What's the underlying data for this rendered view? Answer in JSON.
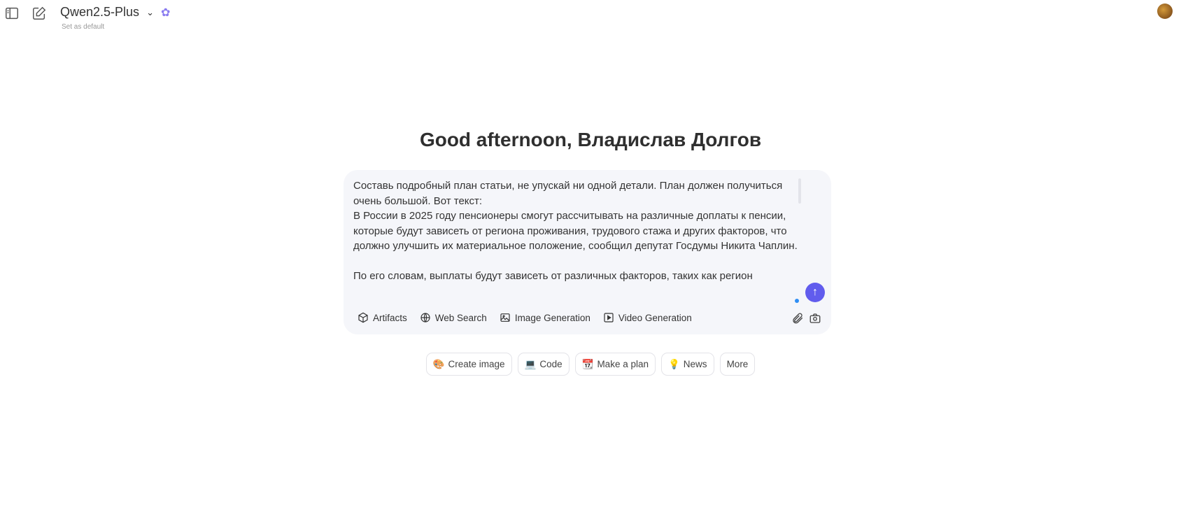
{
  "header": {
    "model_name": "Qwen2.5-Plus",
    "set_default": "Set as default"
  },
  "greeting": "Good afternoon, Владислав Долгов",
  "input": {
    "value": "Составь подробный план статьи, не упускай ни одной детали. План должен получиться очень большой. Вот текст: \nВ России в 2025 году пенсионеры смогут рассчитывать на различные доплаты к пенсии, которые будут зависеть от региона проживания, трудового стажа и других факторов, что должно улучшить их материальное положение, сообщил депутат Госдумы Никита Чаплин.\n\nПо его словам, выплаты будут зависеть от различных факторов, таких как регион"
  },
  "tools": [
    {
      "label": "Artifacts",
      "icon": "cube-icon"
    },
    {
      "label": "Web Search",
      "icon": "globe-icon"
    },
    {
      "label": "Image Generation",
      "icon": "image-icon"
    },
    {
      "label": "Video Generation",
      "icon": "play-icon"
    }
  ],
  "chips": [
    {
      "label": "Create image",
      "icon": "🎨"
    },
    {
      "label": "Code",
      "icon": "💻"
    },
    {
      "label": "Make a plan",
      "icon": "📆"
    },
    {
      "label": "News",
      "icon": "💡"
    },
    {
      "label": "More",
      "icon": ""
    }
  ],
  "colors": {
    "send": "#615ced",
    "box": "#f5f6fa"
  }
}
